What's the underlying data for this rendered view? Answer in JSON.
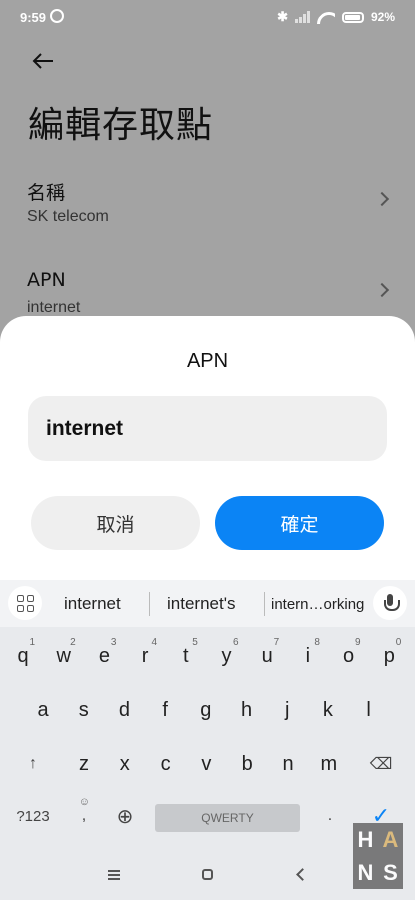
{
  "status_bar": {
    "time": "9:59",
    "battery": "92"
  },
  "page": {
    "title": "編輯存取點",
    "rows": [
      {
        "title": "名稱",
        "value": "SK telecom"
      },
      {
        "title": "APN",
        "value": "internet"
      }
    ]
  },
  "dialog": {
    "title": "APN",
    "input_value": "internet",
    "cancel_label": "取消",
    "ok_label": "確定",
    "ok_color": "#0b84f5"
  },
  "keyboard": {
    "suggestions": [
      "internet",
      "internet's",
      "intern…orking"
    ],
    "row1": [
      {
        "k": "q",
        "n": "1"
      },
      {
        "k": "w",
        "n": "2"
      },
      {
        "k": "e",
        "n": "3"
      },
      {
        "k": "r",
        "n": "4"
      },
      {
        "k": "t",
        "n": "5"
      },
      {
        "k": "y",
        "n": "6"
      },
      {
        "k": "u",
        "n": "7"
      },
      {
        "k": "i",
        "n": "8"
      },
      {
        "k": "o",
        "n": "9"
      },
      {
        "k": "p",
        "n": "0"
      }
    ],
    "row2": [
      "a",
      "s",
      "d",
      "f",
      "g",
      "h",
      "j",
      "k",
      "l"
    ],
    "row3": [
      "z",
      "x",
      "c",
      "v",
      "b",
      "n",
      "m"
    ],
    "symbols_label": "?123",
    "emoji_comma": ",",
    "space_label": "QWERTY",
    "period": "."
  },
  "watermark": {
    "letters": [
      "H",
      "A",
      "N",
      "S"
    ]
  }
}
